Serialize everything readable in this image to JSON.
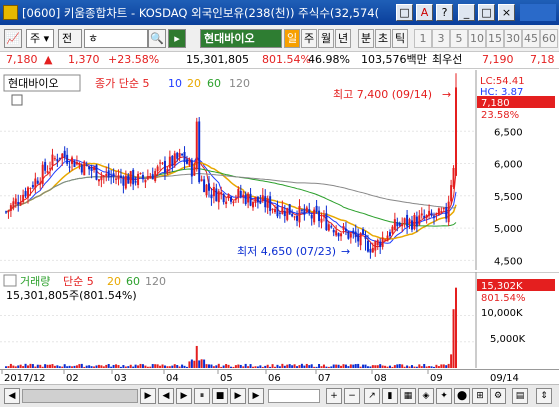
{
  "window": {
    "title": "[0600] 키움종합차트 - KOSDAQ 외국인보유(238(천)) 주식수(32,574(",
    "buttons": [
      "□",
      "A",
      "?",
      "_",
      "□",
      "×"
    ]
  },
  "toolbar": {
    "code": "주",
    "search_value": "ㅎ",
    "market_select": "전",
    "stock_name": "현대바이오",
    "period_tabs": [
      "일",
      "주",
      "월",
      "년",
      "분",
      "초",
      "틱"
    ],
    "numbers": [
      "1",
      "3",
      "5",
      "10",
      "15",
      "30",
      "45",
      "60"
    ]
  },
  "ticker": {
    "price": "7,180",
    "change": "1,370",
    "change_pct": "+23.58%",
    "volume": "15,301,805",
    "vol_ratio": "801.54%",
    "turnover": "46.98%",
    "amount": "103,576백만",
    "pref_label": "최우선",
    "bid": "7,190",
    "ask": "7,18"
  },
  "colors": {
    "up": "#e41f1f",
    "down": "#0a2dd2",
    "ma5": "#e41f1f",
    "ma10": "#1e3cff",
    "ma20": "#e8a800",
    "ma60": "#2ca02c",
    "ma120": "#888888"
  },
  "price_panel": {
    "legend_name": "현대바이오",
    "legend_ma": "종가 단순 5",
    "ma_periods": [
      "10",
      "20",
      "60",
      "120"
    ],
    "high_label": "최고 7,400 (09/14)",
    "low_label": "최저 4,650 (07/23)",
    "lc": "LC:54.41",
    "hc": "HC: 3.87",
    "last_price": "7,180",
    "last_pct": "23.58%",
    "y_ticks": [
      "6,500",
      "6,000",
      "5,500",
      "5,000",
      "4,500"
    ]
  },
  "volume_panel": {
    "legend_name": "거래량",
    "legend_ma": "단순 5",
    "ma_periods": [
      "20",
      "60",
      "120"
    ],
    "current": "15,301,805주(801.54%)",
    "last_vol": "15,302K",
    "last_pct": "801.54%",
    "y_ticks": [
      "10,000K",
      "5,000K"
    ]
  },
  "x_axis": {
    "labels": [
      "2017/12",
      "02",
      "03",
      "04",
      "05",
      "06",
      "07",
      "08",
      "09"
    ],
    "current": "09/14"
  },
  "chart_data": {
    "type": "candlestick",
    "x_range": [
      "2017/12",
      "2018/09/14"
    ],
    "price_ylim": [
      4500,
      7400
    ],
    "anchor_points": [
      {
        "date": "2017/12",
        "close": 5300
      },
      {
        "date": "2018/02",
        "close": 6200
      },
      {
        "date": "2018/04",
        "close": 6500
      },
      {
        "date": "2018/07/23",
        "low": 4650
      },
      {
        "date": "2018/09/14",
        "high": 7400,
        "close": 7180
      }
    ],
    "volume_ylim": [
      0,
      15302
    ]
  }
}
